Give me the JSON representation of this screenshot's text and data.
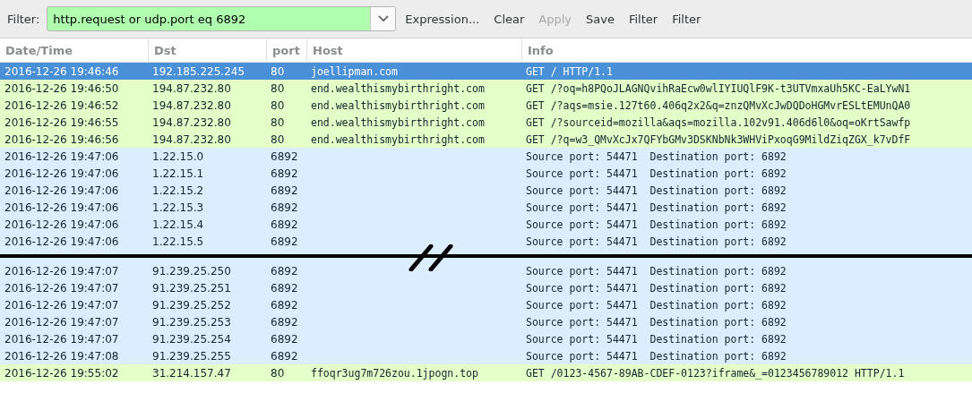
{
  "filter_bar": {
    "label": "Filter:",
    "value": "http.request or udp.port eq 6892",
    "valid": true,
    "buttons": [
      {
        "label": "Expression...",
        "disabled": false
      },
      {
        "label": "Clear",
        "disabled": false
      },
      {
        "label": "Apply",
        "disabled": true
      },
      {
        "label": "Save",
        "disabled": false
      },
      {
        "label": "Filter",
        "disabled": false
      },
      {
        "label": "Filter",
        "disabled": false
      }
    ]
  },
  "table": {
    "columns": [
      "Date/Time",
      "Dst",
      "port",
      "Host",
      "Info"
    ],
    "rows": [
      {
        "kind": "http",
        "selected": true,
        "cells": [
          "2016-12-26 19:46:46",
          "192.185.225.245",
          "80",
          "joellipman.com",
          "GET / HTTP/1.1"
        ]
      },
      {
        "kind": "http",
        "selected": false,
        "cells": [
          "2016-12-26 19:46:50",
          "194.87.232.80",
          "80",
          "end.wealthismybirthright.com",
          "GET /?oq=h8PQoJLAGNQvihRaEcw0wlIYIUQlF9K-t3UTVmxaUh5KC-EaLYwN1"
        ]
      },
      {
        "kind": "http",
        "selected": false,
        "cells": [
          "2016-12-26 19:46:52",
          "194.87.232.80",
          "80",
          "end.wealthismybirthright.com",
          "GET /?aqs=msie.127t60.406q2x2&q=znzQMvXcJwDQDoHGMvrESLtEMUnQA0"
        ]
      },
      {
        "kind": "http",
        "selected": false,
        "cells": [
          "2016-12-26 19:46:55",
          "194.87.232.80",
          "80",
          "end.wealthismybirthright.com",
          "GET /?sourceid=mozilla&aqs=mozilla.102v91.406d6l0&oq=oKrtSawfp"
        ]
      },
      {
        "kind": "http",
        "selected": false,
        "cells": [
          "2016-12-26 19:46:56",
          "194.87.232.80",
          "80",
          "end.wealthismybirthright.com",
          "GET /?q=w3_QMvXcJx7QFYbGMv3DSKNbNk3WHViPxoqG9MildZiqZGX_k7vDfF"
        ]
      },
      {
        "kind": "udp",
        "selected": false,
        "cells": [
          "2016-12-26 19:47:06",
          "1.22.15.0",
          "6892",
          "",
          "Source port: 54471  Destination port: 6892"
        ]
      },
      {
        "kind": "udp",
        "selected": false,
        "cells": [
          "2016-12-26 19:47:06",
          "1.22.15.1",
          "6892",
          "",
          "Source port: 54471  Destination port: 6892"
        ]
      },
      {
        "kind": "udp",
        "selected": false,
        "cells": [
          "2016-12-26 19:47:06",
          "1.22.15.2",
          "6892",
          "",
          "Source port: 54471  Destination port: 6892"
        ]
      },
      {
        "kind": "udp",
        "selected": false,
        "cells": [
          "2016-12-26 19:47:06",
          "1.22.15.3",
          "6892",
          "",
          "Source port: 54471  Destination port: 6892"
        ]
      },
      {
        "kind": "udp",
        "selected": false,
        "cells": [
          "2016-12-26 19:47:06",
          "1.22.15.4",
          "6892",
          "",
          "Source port: 54471  Destination port: 6892"
        ]
      },
      {
        "kind": "udp",
        "selected": false,
        "cells": [
          "2016-12-26 19:47:06",
          "1.22.15.5",
          "6892",
          "",
          "Source port: 54471  Destination port: 6892"
        ]
      },
      {
        "kind": "break"
      },
      {
        "kind": "udp",
        "selected": false,
        "cells": [
          "2016-12-26 19:47:07",
          "91.239.25.250",
          "6892",
          "",
          "Source port: 54471  Destination port: 6892"
        ]
      },
      {
        "kind": "udp",
        "selected": false,
        "cells": [
          "2016-12-26 19:47:07",
          "91.239.25.251",
          "6892",
          "",
          "Source port: 54471  Destination port: 6892"
        ]
      },
      {
        "kind": "udp",
        "selected": false,
        "cells": [
          "2016-12-26 19:47:07",
          "91.239.25.252",
          "6892",
          "",
          "Source port: 54471  Destination port: 6892"
        ]
      },
      {
        "kind": "udp",
        "selected": false,
        "cells": [
          "2016-12-26 19:47:07",
          "91.239.25.253",
          "6892",
          "",
          "Source port: 54471  Destination port: 6892"
        ]
      },
      {
        "kind": "udp",
        "selected": false,
        "cells": [
          "2016-12-26 19:47:07",
          "91.239.25.254",
          "6892",
          "",
          "Source port: 54471  Destination port: 6892"
        ]
      },
      {
        "kind": "udp",
        "selected": false,
        "cells": [
          "2016-12-26 19:47:08",
          "91.239.25.255",
          "6892",
          "",
          "Source port: 54471  Destination port: 6892"
        ]
      },
      {
        "kind": "http",
        "selected": false,
        "cells": [
          "2016-12-26 19:55:02",
          "31.214.157.47",
          "80",
          "ffoqr3ug7m726zou.1jpogn.top",
          "GET /0123-4567-89AB-CDEF-0123?iframe&_=0123456789012 HTTP/1.1"
        ]
      }
    ]
  }
}
